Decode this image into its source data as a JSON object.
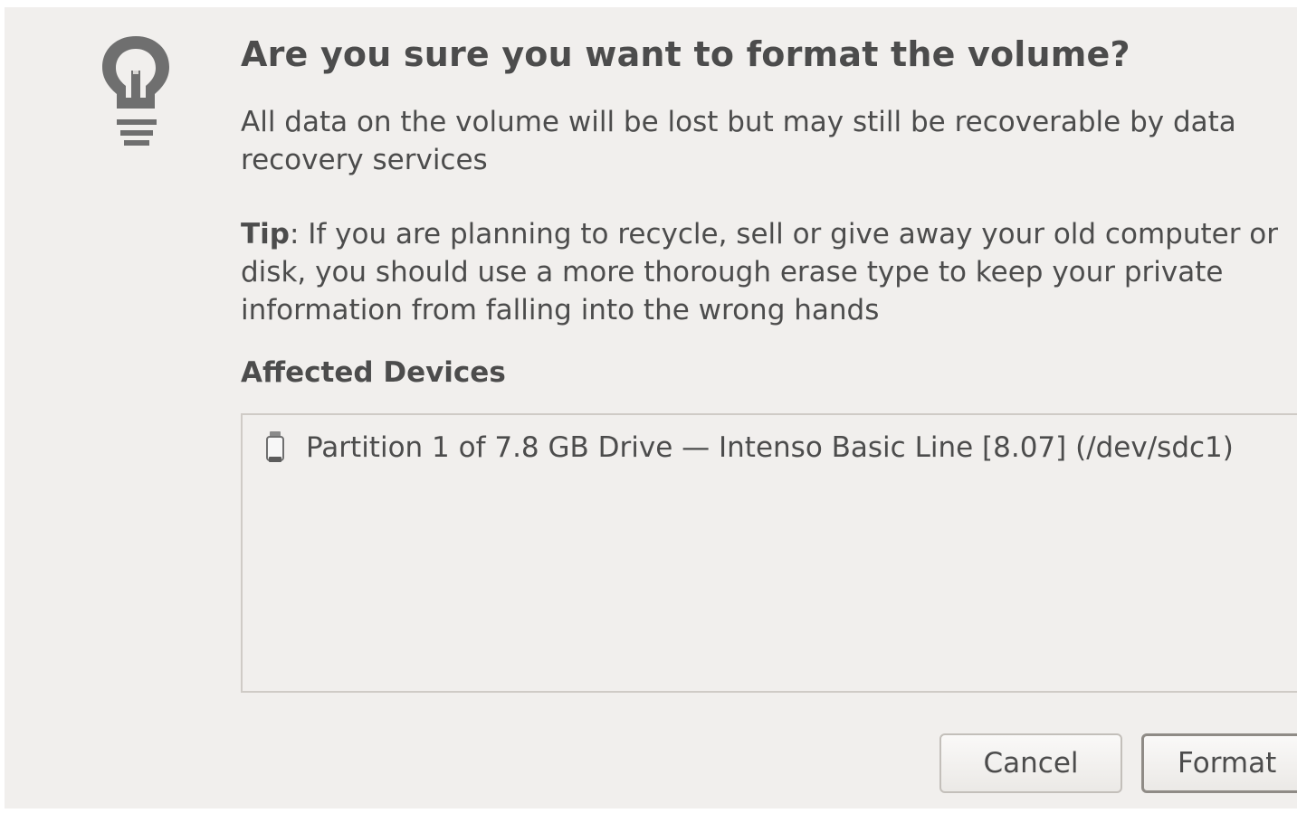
{
  "dialog": {
    "icon": "lightbulb-icon",
    "title": "Are you sure you want to format the volume?",
    "message": "All data on the volume will be lost but may still be recoverable by data recovery services",
    "tip_label": "Tip",
    "tip_text": ": If you are planning to recycle, sell or give away your old computer or disk, you should use a more thorough erase type to keep your private information from falling into the wrong hands",
    "affected_heading": "Affected Devices",
    "devices": [
      {
        "icon": "usb-drive-icon",
        "label": "Partition 1 of 7.8 GB Drive — Intenso Basic Line [8.07] (/dev/sdc1)"
      }
    ],
    "buttons": {
      "cancel_label": "Cancel",
      "format_label": "Format"
    }
  }
}
